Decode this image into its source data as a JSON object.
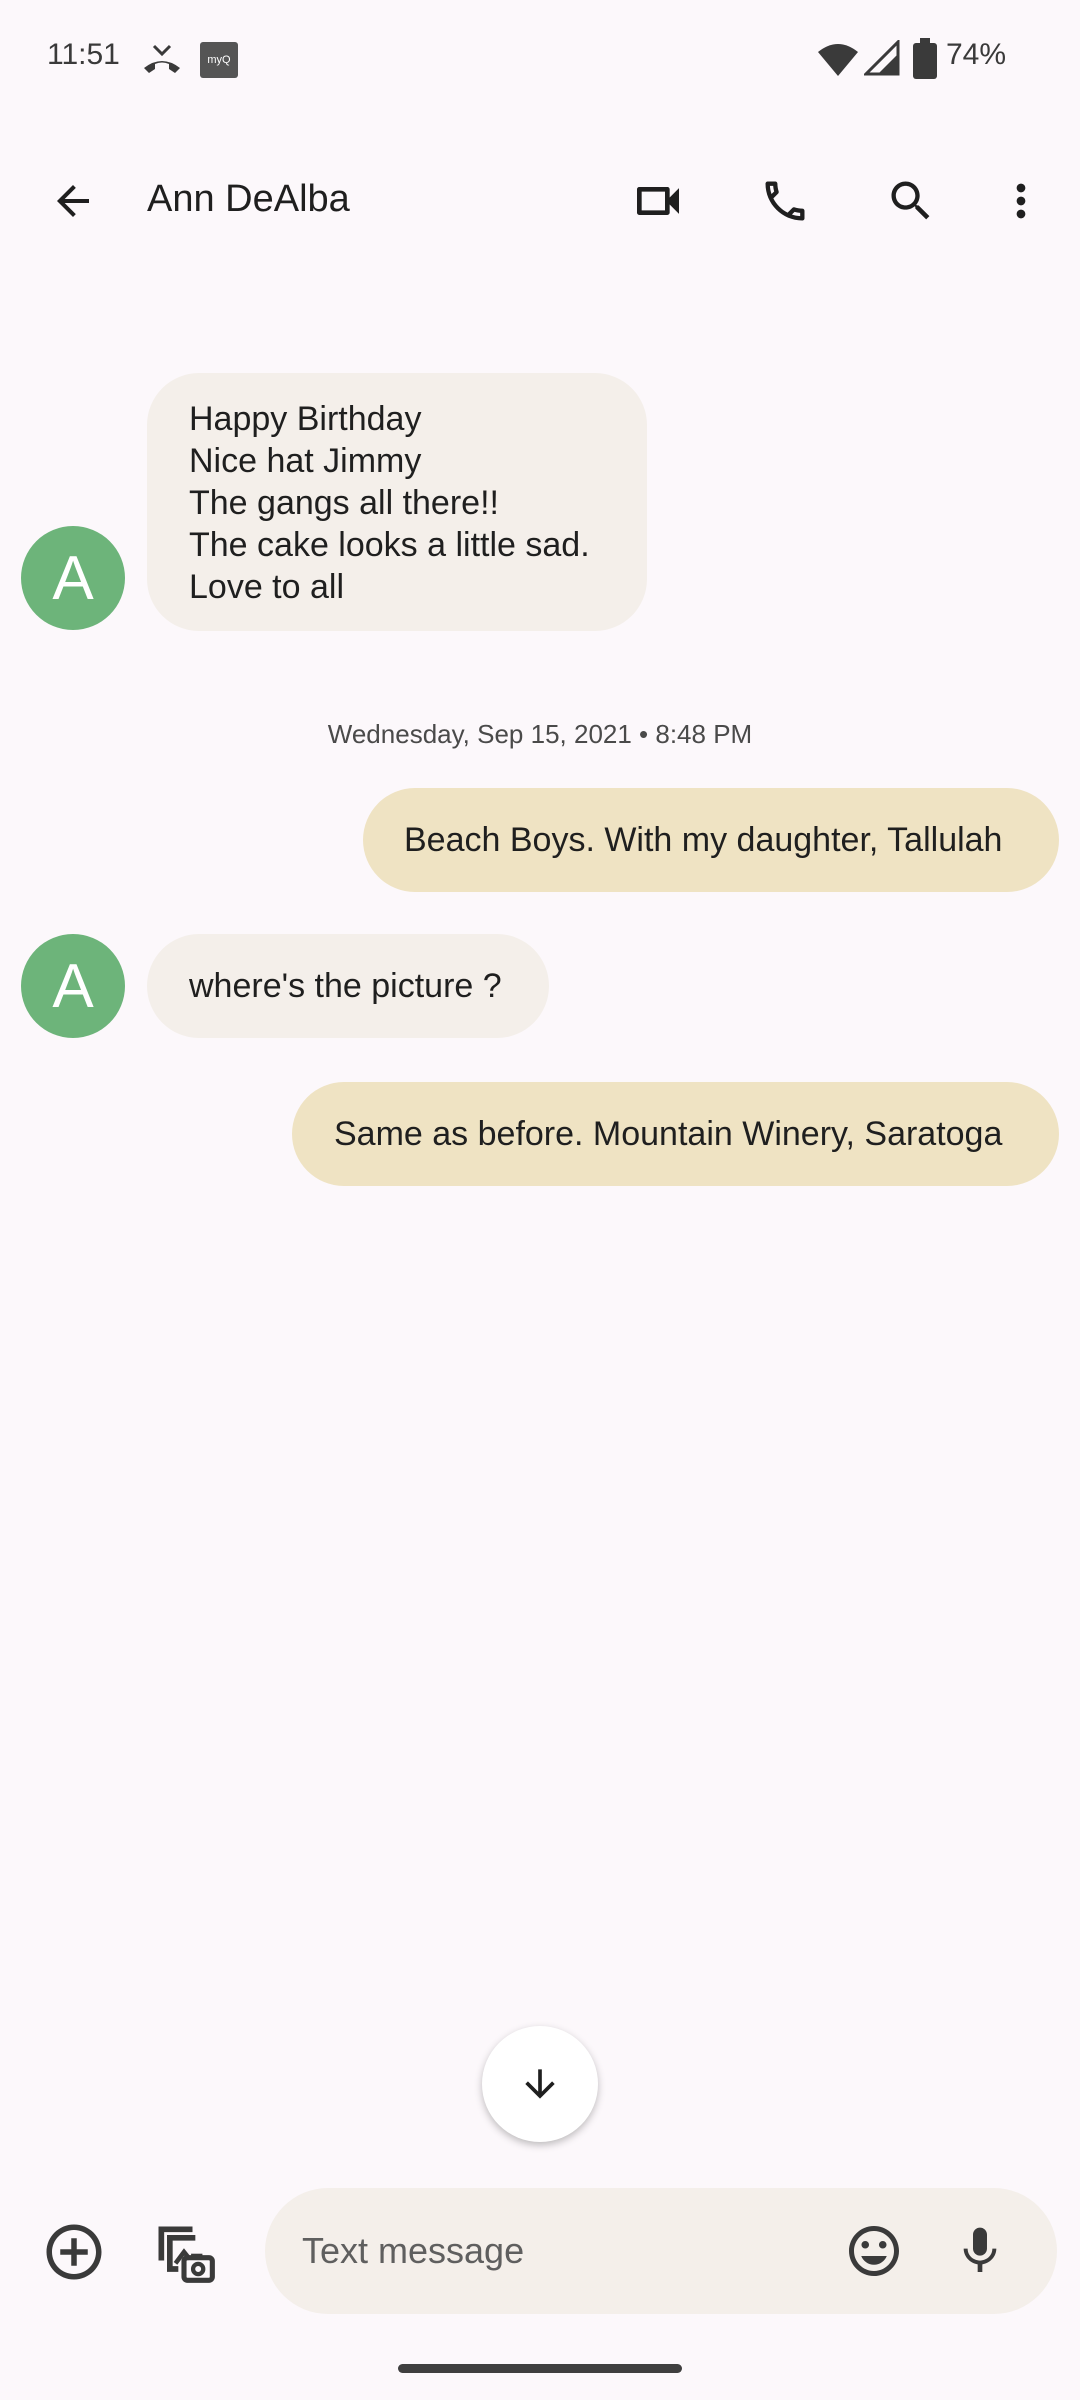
{
  "status_bar": {
    "time": "11:51",
    "battery": "74%",
    "myq_label": "myQ"
  },
  "header": {
    "contact_name": "Ann DeAlba"
  },
  "conversation": {
    "timestamp": "Wednesday, Sep 15, 2021 • 8:48 PM",
    "messages": [
      {
        "direction": "incoming",
        "avatar_letter": "A",
        "lines": [
          "Happy Birthday",
          "Nice hat Jimmy",
          "The gangs all there!!",
          "The cake looks a little sad.",
          "Love to all"
        ]
      },
      {
        "direction": "outgoing",
        "text": "Beach Boys. With my daughter, Tallulah"
      },
      {
        "direction": "incoming",
        "avatar_letter": "A",
        "text": "where's the picture ?"
      },
      {
        "direction": "outgoing",
        "text": "Same as before. Mountain Winery, Saratoga"
      }
    ]
  },
  "compose": {
    "placeholder": "Text message",
    "value": ""
  },
  "colors": {
    "background": "#fcf8fb",
    "incoming_bubble": "#f4efea",
    "outgoing_bubble": "#efe3c3",
    "avatar": "#6db47a"
  },
  "icons": {
    "back": "arrow-left",
    "video": "video-camera",
    "call": "phone",
    "search": "magnifier",
    "more": "vertical-dots",
    "scroll": "arrow-down",
    "add": "plus-circle",
    "gallery": "gallery-camera",
    "emoji": "smiley",
    "mic": "microphone"
  }
}
